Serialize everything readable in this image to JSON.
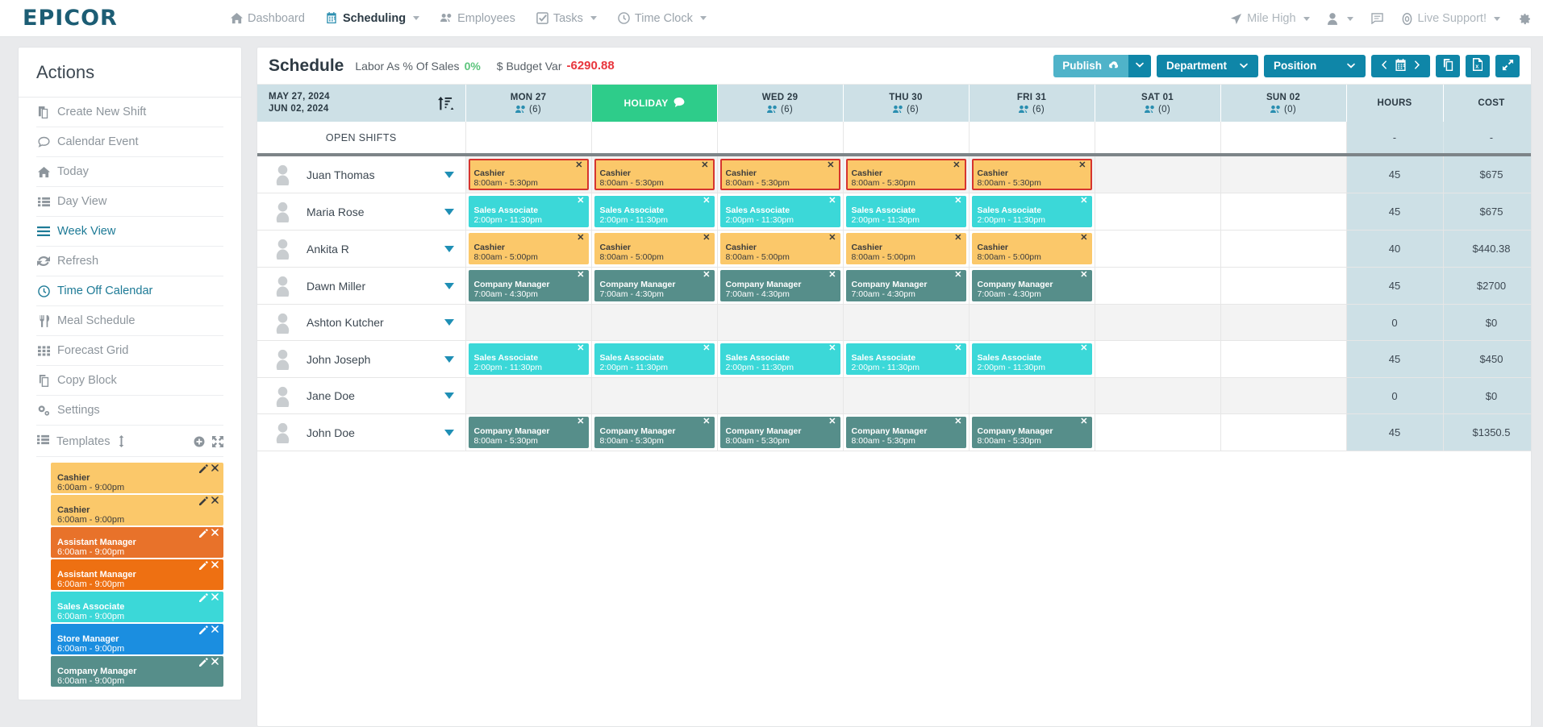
{
  "topnav": {
    "logo": "EPICOR",
    "items": [
      {
        "label": "Dashboard",
        "icon": "home-icon",
        "caret": false,
        "active": false
      },
      {
        "label": "Scheduling",
        "icon": "calendar-icon",
        "caret": true,
        "active": true
      },
      {
        "label": "Employees",
        "icon": "people-icon",
        "caret": false,
        "active": false
      },
      {
        "label": "Tasks",
        "icon": "check-square-icon",
        "caret": true,
        "active": false
      },
      {
        "label": "Time Clock",
        "icon": "clock-icon",
        "caret": true,
        "active": false
      }
    ],
    "right": [
      {
        "label": "Mile High",
        "icon": "location-arrow-icon",
        "caret": true
      },
      {
        "label": "",
        "icon": "user-icon",
        "caret": true
      },
      {
        "label": "",
        "icon": "message-icon",
        "caret": false
      },
      {
        "label": "Live Support!",
        "icon": "lifebuoy-icon",
        "caret": true
      }
    ],
    "settings_icon": "gear-icon"
  },
  "sidebar": {
    "title": "Actions",
    "actions": [
      {
        "label": "Create New Shift",
        "icon": "copy-file-icon",
        "active": false
      },
      {
        "label": "Calendar Event",
        "icon": "comment-icon",
        "active": false
      },
      {
        "label": "Today",
        "icon": "home-icon",
        "active": false
      },
      {
        "label": "Day View",
        "icon": "list-icon",
        "active": false
      },
      {
        "label": "Week View",
        "icon": "bars-icon",
        "active": true
      },
      {
        "label": "Refresh",
        "icon": "refresh-icon",
        "active": false
      },
      {
        "label": "Time Off Calendar",
        "icon": "clock-icon",
        "active": true
      },
      {
        "label": "Meal Schedule",
        "icon": "utensils-icon",
        "active": false
      },
      {
        "label": "Forecast Grid",
        "icon": "grid-icon",
        "active": false
      },
      {
        "label": "Copy Block",
        "icon": "copy-icon",
        "active": false
      },
      {
        "label": "Settings",
        "icon": "gears-icon",
        "active": false
      }
    ],
    "templates_header": {
      "label": "Templates",
      "resize_icon": "vertical-resize-icon",
      "add_icon": "plus-circle-icon",
      "expand_icon": "expand-arrows-icon"
    },
    "templates": [
      {
        "role": "Cashier",
        "time": "6:00am - 9:00pm",
        "color": "#fbc86a",
        "text": "#3c3c3c"
      },
      {
        "role": "Cashier",
        "time": "6:00am - 9:00pm",
        "color": "#fbc86a",
        "text": "#3c3c3c"
      },
      {
        "role": "Assistant Manager",
        "time": "6:00am - 9:00pm",
        "color": "#e8722a",
        "text": "#ffffff"
      },
      {
        "role": "Assistant Manager",
        "time": "6:00am - 9:00pm",
        "color": "#ee7012",
        "text": "#ffffff"
      },
      {
        "role": "Sales Associate",
        "time": "6:00am - 9:00pm",
        "color": "#3bd8d8",
        "text": "#ffffff"
      },
      {
        "role": "Store Manager",
        "time": "6:00am - 9:00pm",
        "color": "#1b8ee0",
        "text": "#ffffff"
      },
      {
        "role": "Company Manager",
        "time": "6:00am - 9:00pm",
        "color": "#568e8a",
        "text": "#ffffff"
      }
    ],
    "template_edit_icon": "edit-icon",
    "template_delete_icon": "close-icon"
  },
  "header": {
    "title": "Schedule",
    "labor_label": "Labor As % Of Sales",
    "labor_value": "0%",
    "budget_label": "$ Budget Var",
    "budget_value": "-6290.88",
    "buttons": {
      "publish": "Publish",
      "publish_icon": "cloud-upload-icon",
      "publish_caret_icon": "chevron-down-icon",
      "department": "Department",
      "position": "Position",
      "prev_icon": "chevron-left-icon",
      "calendar_icon": "calendar-icon",
      "next_icon": "chevron-right-icon",
      "copy_icon": "copy-icon",
      "excel_icon": "excel-file-icon",
      "fullscreen_icon": "expand-icon"
    }
  },
  "grid": {
    "date_range_line1": "MAY 27, 2024",
    "date_range_line2": "JUN 02, 2024",
    "sort_icon": "sort-amount-icon",
    "columns": [
      {
        "label": "MON 27",
        "count": "(6)",
        "holiday": false
      },
      {
        "label": "HOLIDAY",
        "count": "",
        "holiday": true,
        "holiday_icon": "comment-icon"
      },
      {
        "label": "WED 29",
        "count": "(6)",
        "holiday": false
      },
      {
        "label": "THU 30",
        "count": "(6)",
        "holiday": false
      },
      {
        "label": "FRI 31",
        "count": "(6)",
        "holiday": false
      },
      {
        "label": "SAT 01",
        "count": "(0)",
        "holiday": false
      },
      {
        "label": "SUN 02",
        "count": "(0)",
        "holiday": false
      }
    ],
    "hours_header": "HOURS",
    "cost_header": "COST",
    "open_shifts_label": "OPEN SHIFTS",
    "open_shifts_hours": "-",
    "open_shifts_cost": "-",
    "employees": [
      {
        "name": "Juan Thomas",
        "hours": "45",
        "cost": "$675",
        "alt": true,
        "shifts": [
          {
            "role": "Cashier",
            "time": "8:00am - 5:30pm",
            "color": "#fbc86a",
            "text": "#3c3c3c",
            "alert": true
          },
          {
            "role": "Cashier",
            "time": "8:00am - 5:30pm",
            "color": "#fbc86a",
            "text": "#3c3c3c",
            "alert": true
          },
          {
            "role": "Cashier",
            "time": "8:00am - 5:30pm",
            "color": "#fbc86a",
            "text": "#3c3c3c",
            "alert": true
          },
          {
            "role": "Cashier",
            "time": "8:00am - 5:30pm",
            "color": "#fbc86a",
            "text": "#3c3c3c",
            "alert": true
          },
          {
            "role": "Cashier",
            "time": "8:00am - 5:30pm",
            "color": "#fbc86a",
            "text": "#3c3c3c",
            "alert": true
          },
          null,
          null
        ]
      },
      {
        "name": "Maria Rose",
        "hours": "45",
        "cost": "$675",
        "alt": false,
        "shifts": [
          {
            "role": "Sales Associate",
            "time": "2:00pm - 11:30pm",
            "color": "#3bd8d8",
            "text": "#ffffff",
            "alert": false
          },
          {
            "role": "Sales Associate",
            "time": "2:00pm - 11:30pm",
            "color": "#3bd8d8",
            "text": "#ffffff",
            "alert": false
          },
          {
            "role": "Sales Associate",
            "time": "2:00pm - 11:30pm",
            "color": "#3bd8d8",
            "text": "#ffffff",
            "alert": false
          },
          {
            "role": "Sales Associate",
            "time": "2:00pm - 11:30pm",
            "color": "#3bd8d8",
            "text": "#ffffff",
            "alert": false
          },
          {
            "role": "Sales Associate",
            "time": "2:00pm - 11:30pm",
            "color": "#3bd8d8",
            "text": "#ffffff",
            "alert": false
          },
          null,
          null
        ]
      },
      {
        "name": "Ankita R",
        "hours": "40",
        "cost": "$440.38",
        "alt": false,
        "shifts": [
          {
            "role": "Cashier",
            "time": "8:00am - 5:00pm",
            "color": "#fbc86a",
            "text": "#3c3c3c",
            "alert": false
          },
          {
            "role": "Cashier",
            "time": "8:00am - 5:00pm",
            "color": "#fbc86a",
            "text": "#3c3c3c",
            "alert": false
          },
          {
            "role": "Cashier",
            "time": "8:00am - 5:00pm",
            "color": "#fbc86a",
            "text": "#3c3c3c",
            "alert": false
          },
          {
            "role": "Cashier",
            "time": "8:00am - 5:00pm",
            "color": "#fbc86a",
            "text": "#3c3c3c",
            "alert": false
          },
          {
            "role": "Cashier",
            "time": "8:00am - 5:00pm",
            "color": "#fbc86a",
            "text": "#3c3c3c",
            "alert": false
          },
          null,
          null
        ]
      },
      {
        "name": "Dawn Miller",
        "hours": "45",
        "cost": "$2700",
        "alt": false,
        "shifts": [
          {
            "role": "Company Manager",
            "time": "7:00am - 4:30pm",
            "color": "#568e8a",
            "text": "#ffffff",
            "alert": false
          },
          {
            "role": "Company Manager",
            "time": "7:00am - 4:30pm",
            "color": "#568e8a",
            "text": "#ffffff",
            "alert": false
          },
          {
            "role": "Company Manager",
            "time": "7:00am - 4:30pm",
            "color": "#568e8a",
            "text": "#ffffff",
            "alert": false
          },
          {
            "role": "Company Manager",
            "time": "7:00am - 4:30pm",
            "color": "#568e8a",
            "text": "#ffffff",
            "alert": false
          },
          {
            "role": "Company Manager",
            "time": "7:00am - 4:30pm",
            "color": "#568e8a",
            "text": "#ffffff",
            "alert": false
          },
          null,
          null
        ]
      },
      {
        "name": "Ashton Kutcher",
        "hours": "0",
        "cost": "$0",
        "alt": true,
        "shifts": [
          null,
          null,
          null,
          null,
          null,
          null,
          null
        ]
      },
      {
        "name": "John Joseph",
        "hours": "45",
        "cost": "$450",
        "alt": false,
        "shifts": [
          {
            "role": "Sales Associate",
            "time": "2:00pm - 11:30pm",
            "color": "#3bd8d8",
            "text": "#ffffff",
            "alert": false
          },
          {
            "role": "Sales Associate",
            "time": "2:00pm - 11:30pm",
            "color": "#3bd8d8",
            "text": "#ffffff",
            "alert": false
          },
          {
            "role": "Sales Associate",
            "time": "2:00pm - 11:30pm",
            "color": "#3bd8d8",
            "text": "#ffffff",
            "alert": false
          },
          {
            "role": "Sales Associate",
            "time": "2:00pm - 11:30pm",
            "color": "#3bd8d8",
            "text": "#ffffff",
            "alert": false
          },
          {
            "role": "Sales Associate",
            "time": "2:00pm - 11:30pm",
            "color": "#3bd8d8",
            "text": "#ffffff",
            "alert": false
          },
          null,
          null
        ]
      },
      {
        "name": "Jane Doe",
        "hours": "0",
        "cost": "$0",
        "alt": true,
        "shifts": [
          null,
          null,
          null,
          null,
          null,
          null,
          null
        ]
      },
      {
        "name": "John Doe",
        "hours": "45",
        "cost": "$1350.5",
        "alt": false,
        "shifts": [
          {
            "role": "Company Manager",
            "time": "8:00am - 5:30pm",
            "color": "#568e8a",
            "text": "#ffffff",
            "alert": false
          },
          {
            "role": "Company Manager",
            "time": "8:00am - 5:30pm",
            "color": "#568e8a",
            "text": "#ffffff",
            "alert": false
          },
          {
            "role": "Company Manager",
            "time": "8:00am - 5:30pm",
            "color": "#568e8a",
            "text": "#ffffff",
            "alert": false
          },
          {
            "role": "Company Manager",
            "time": "8:00am - 5:30pm",
            "color": "#568e8a",
            "text": "#ffffff",
            "alert": false
          },
          {
            "role": "Company Manager",
            "time": "8:00am - 5:30pm",
            "color": "#568e8a",
            "text": "#ffffff",
            "alert": false
          },
          null,
          null
        ]
      }
    ]
  }
}
